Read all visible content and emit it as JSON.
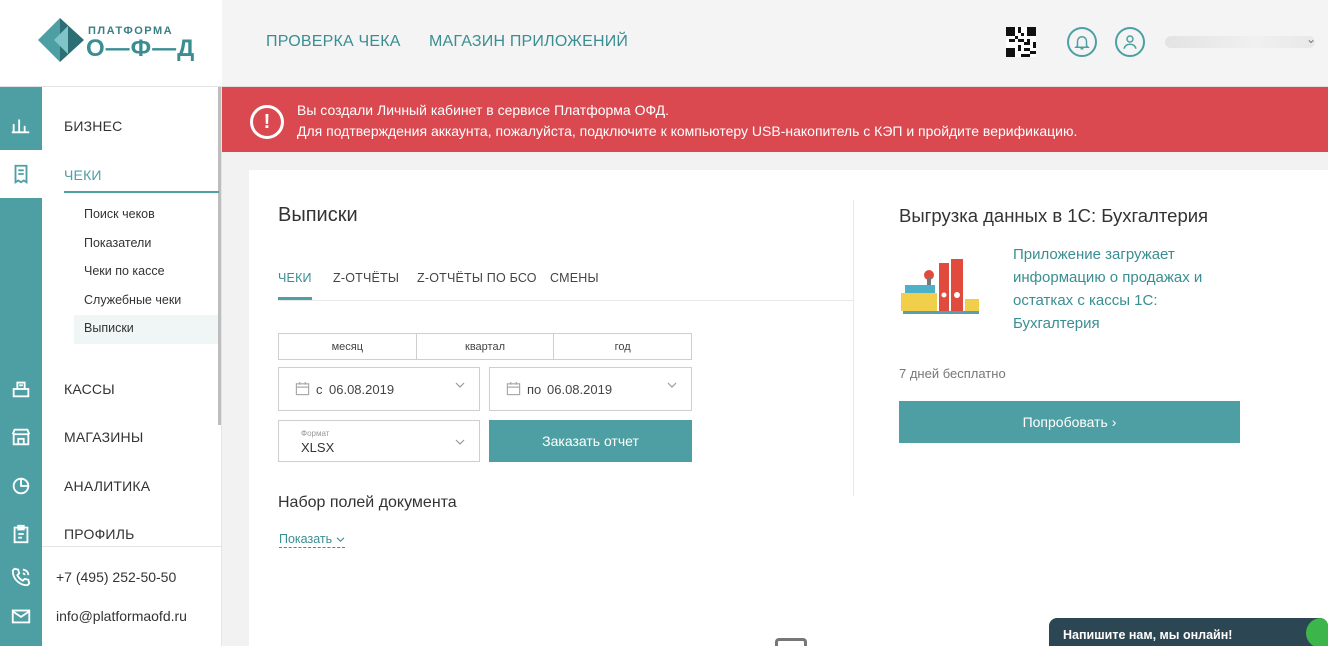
{
  "logo": {
    "line1": "ПЛАТФОРМА",
    "line2": "О—Ф—Д"
  },
  "header": {
    "nav": [
      "ПРОВЕРКА ЧЕКА",
      "МАГАЗИН ПРИЛОЖЕНИЙ"
    ],
    "user_chevron": "⌄"
  },
  "alert": {
    "icon": "!",
    "line1": "Вы создали Личный кабинет в сервисе Платформа ОФД.",
    "line2": "Для подтверждения аккаунта, пожалуйста, подключите к компьютеру USB-накопитель с КЭП и пройдите верификацию."
  },
  "sidebar": {
    "sections": [
      "БИЗНЕС",
      "ЧЕКИ",
      "КАССЫ",
      "МАГАЗИНЫ",
      "АНАЛИТИКА",
      "ПРОФИЛЬ"
    ],
    "sub_items": [
      "Поиск чеков",
      "Показатели",
      "Чеки по кассе",
      "Служебные чеки",
      "Выписки"
    ],
    "phone": "+7 (495) 252-50-50",
    "email": "info@platformaofd.ru"
  },
  "main": {
    "title": "Выписки",
    "tabs": [
      "ЧЕКИ",
      "Z-ОТЧЁТЫ",
      "Z-ОТЧЁТЫ ПО БСО",
      "СМЕНЫ"
    ],
    "period": [
      "месяц",
      "квартал",
      "год"
    ],
    "date_from_prefix": "с",
    "date_from": "06.08.2019",
    "date_to_prefix": "по",
    "date_to": "06.08.2019",
    "format_label": "Формат",
    "format_value": "XLSX",
    "order_button": "Заказать отчет",
    "fields_title": "Набор полей документа",
    "show_link": "Показать"
  },
  "promo": {
    "title": "Выгрузка данных в 1С: Бухгалтерия",
    "description": "Приложение загружает информацию о продажах и остатках с кассы 1С: Бухгалтерия",
    "trial": "7 дней бесплатно",
    "button": "Попробовать ›"
  },
  "chat": {
    "label": "Напишите нам, мы онлайн!"
  },
  "colors": {
    "accent": "#4e9fa3",
    "alert": "#d9494f",
    "chat": "#2d4654"
  }
}
